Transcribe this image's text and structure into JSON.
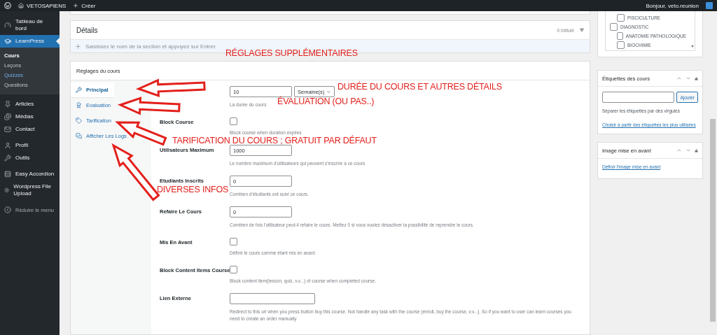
{
  "admin_bar": {
    "site": "VETOSAPIENS",
    "new": "Créer",
    "greeting": "Bonjour, veto.reunion"
  },
  "sidebar": {
    "groups": [
      {
        "items": [
          {
            "label": "Tableau de bord",
            "selected": false
          },
          {
            "label": "LearnPress",
            "selected": true,
            "children": [
              {
                "label": "Cours",
                "selected": true,
                "hover": false
              },
              {
                "label": "Leçons",
                "selected": false,
                "hover": false
              },
              {
                "label": "Quizzes",
                "selected": false,
                "hover": true
              },
              {
                "label": "Questions",
                "selected": false,
                "hover": false
              }
            ]
          }
        ]
      },
      {
        "items": [
          {
            "label": "Articles",
            "selected": false
          },
          {
            "label": "Médias",
            "selected": false
          },
          {
            "label": "Contact",
            "selected": false
          }
        ]
      },
      {
        "items": [
          {
            "label": "Profil",
            "selected": false
          },
          {
            "label": "Outils",
            "selected": false
          }
        ]
      },
      {
        "items": [
          {
            "label": "Easy Accordion",
            "selected": false
          },
          {
            "label": "Wordpress File Upload",
            "selected": false
          }
        ]
      }
    ],
    "collapse": "Réduire le menu"
  },
  "sections_box": {
    "title": "Détails",
    "count": "0 Intitulé",
    "placeholder": "Saisissez le nom de la section et appuyez sur Entrer"
  },
  "settings": {
    "title": "Réglages du cours",
    "tabs": [
      {
        "label": "Principal",
        "selected": true
      },
      {
        "label": "Evaluation",
        "selected": false
      },
      {
        "label": "Tarification",
        "selected": false
      },
      {
        "label": "Afficher Les Logs",
        "selected": false
      }
    ],
    "fields": [
      {
        "kind": "duration",
        "value": "10",
        "unit": "Semaine(s)",
        "help": "La durée du cours"
      },
      {
        "kind": "checkbox",
        "label": "Block Course",
        "checked": false,
        "help": "Block course when duration expires"
      },
      {
        "kind": "text",
        "label": "Utilisateurs Maximum",
        "value": "1000",
        "help": "Le nombre maximum d'utilisateurs qui peuvent s'inscrire à ce cours"
      },
      {
        "kind": "text",
        "label": "Etudiants Inscrits",
        "value": "0",
        "help": "Combien d'étudiants ont suivi ce cours."
      },
      {
        "kind": "text",
        "label": "Refaire Le Cours",
        "value": "0",
        "help": "Combien de fois l'utilisateur peut-il refaire le cours. Mettez 0 si vous voulez désactiver la possibilité de reprendre le cours."
      },
      {
        "kind": "checkbox",
        "label": "Mis En Avant",
        "checked": false,
        "help": "Définir le cours comme étant mis en avant."
      },
      {
        "kind": "checkbox",
        "label": "Block Content Items Course",
        "checked": false,
        "help": "Block content item(lesson, quiz, v.v...) of course when completed course."
      },
      {
        "kind": "url",
        "label": "Lien Externe",
        "help": "Redirect to this url when you press button buy this course. Not handle any task with the course (enroll, buy the course, v.v...). So if you want to user can learn courses you need to create an order manually"
      }
    ]
  },
  "categories": {
    "items": [
      {
        "children": [
          {
            "label": "PISCICULTURE",
            "checked": false
          }
        ]
      },
      {
        "label": "DIAGNOSTIC",
        "checked": false,
        "children": [
          {
            "label": "ANATOMIE PATHOLOGIQUE",
            "checked": false
          },
          {
            "label": "BIOCHIMIE",
            "checked": false
          }
        ]
      }
    ]
  },
  "tags_box": {
    "title": "Étiquettes des cours",
    "button": "Ajouter",
    "help": "Séparer les étiquettes par des virgules",
    "link": "Choisir à partir des étiquettes les plus utilisées"
  },
  "featured_image": {
    "title": "Image mise en avant",
    "link": "Définir l'image mise en avant"
  },
  "annotations": [
    "RÉGLAGES SUPPLÉMENTAIRES",
    "DURÉE DU COURS ET AUTRES DÉTAILS",
    "ÉVALUATION (OU PAS..)",
    "TARIFICATION DU COURS ; GRATUIT PAR DÉFAUT",
    "DIVERSES INFOS"
  ]
}
